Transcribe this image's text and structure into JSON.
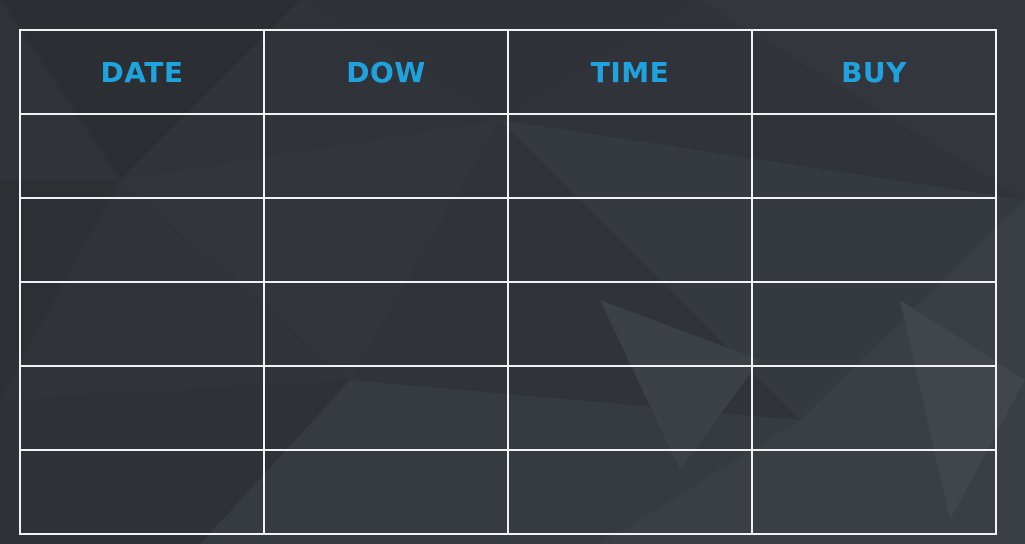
{
  "table": {
    "headers": [
      "DATE",
      "DOW",
      "TIME",
      "BUY"
    ],
    "rows": [
      [
        "",
        "",
        "",
        ""
      ],
      [
        "",
        "",
        "",
        ""
      ],
      [
        "",
        "",
        "",
        ""
      ],
      [
        "",
        "",
        "",
        ""
      ],
      [
        "",
        "",
        "",
        ""
      ]
    ]
  },
  "colors": {
    "background": "#30343a",
    "grid_lines": "#f2f2f2",
    "header_text": "#1fa3df"
  }
}
